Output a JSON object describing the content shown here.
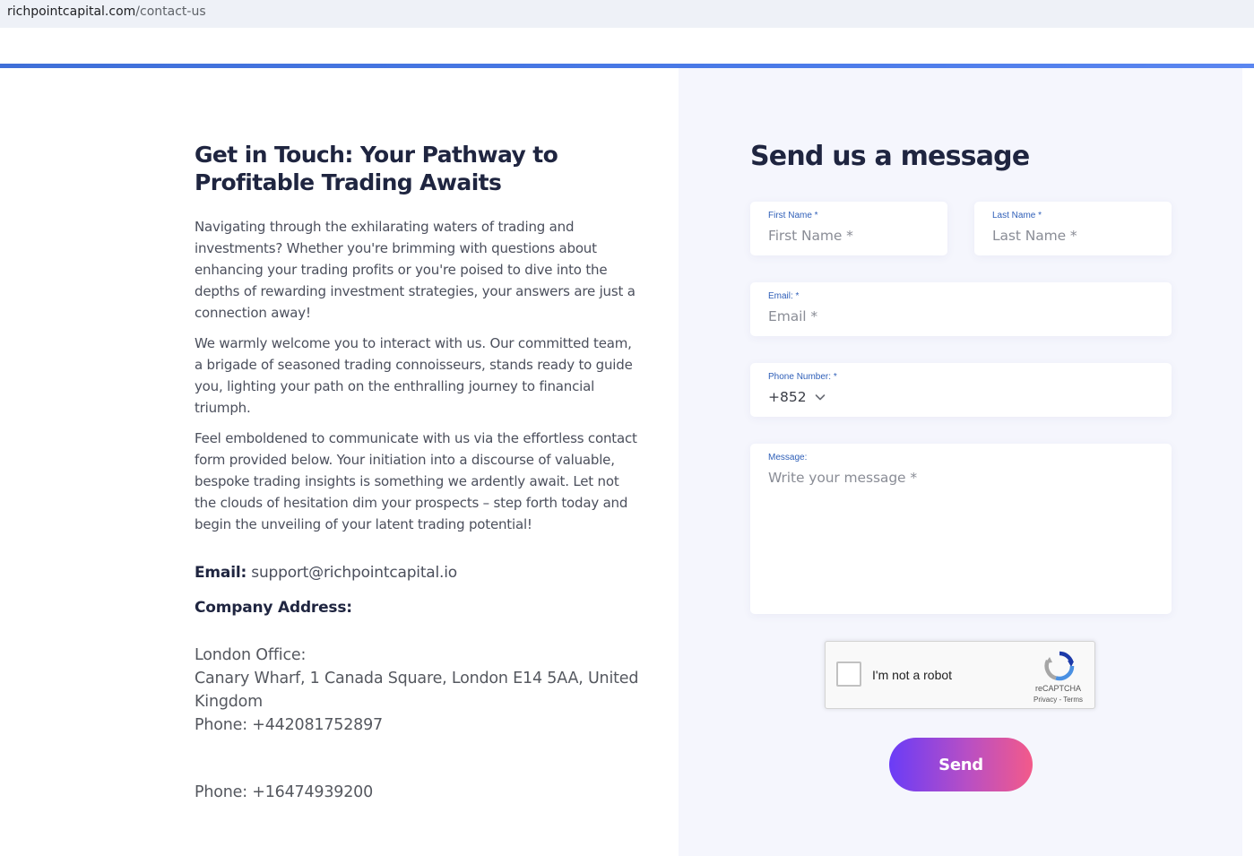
{
  "browser": {
    "url_domain": "richpointcapital.com",
    "url_path": "/contact-us"
  },
  "intro": {
    "title": "Get in Touch: Your Pathway to Profitable Trading Awaits",
    "paragraphs": [
      "Navigating through the exhilarating waters of trading and investments? Whether you're brimming with questions about enhancing your trading profits or you're poised to dive into the depths of rewarding investment strategies, your answers are just a connection away!",
      "We warmly welcome you to interact with us. Our committed team, a brigade of seasoned trading connoisseurs, stands ready to guide you, lighting your path on the enthralling journey to financial triumph.",
      "Feel emboldened to communicate with us via the effortless contact form provided below. Your initiation into a discourse of valuable, bespoke trading insights is something we ardently await. Let not the clouds of hesitation dim your prospects – step forth today and begin the unveiling of your latent trading potential!"
    ]
  },
  "contact": {
    "email_label": "Email:",
    "email_value": "support@richpointcapital.io",
    "address_label": "Company Address:",
    "office_name": "London Office:",
    "office_address": "Canary Wharf, 1 Canada Square, London E14 5AA, United Kingdom",
    "office_phone": "Phone: +442081752897",
    "phone_2": "Phone: +16474939200"
  },
  "form": {
    "title": "Send us a message",
    "first_name": {
      "label": "First Name *",
      "placeholder": "First Name *"
    },
    "last_name": {
      "label": "Last Name *",
      "placeholder": "Last Name *"
    },
    "email": {
      "label": "Email: *",
      "placeholder": "Email *"
    },
    "phone": {
      "label": "Phone Number: *",
      "country_code": "+852"
    },
    "message": {
      "label": "Message:",
      "placeholder": "Write your message *"
    },
    "captcha": {
      "checkbox_text": "I'm not a robot",
      "brand": "reCAPTCHA",
      "privacy": "Privacy",
      "separator": " - ",
      "terms": "Terms"
    },
    "send_label": "Send"
  },
  "colors": {
    "accent_bar": "#4a7ae8",
    "heading": "#1f2540",
    "label_blue": "#2f5fb8",
    "button_gradient_start": "#6a3cf7",
    "button_gradient_end": "#f35a8a"
  }
}
